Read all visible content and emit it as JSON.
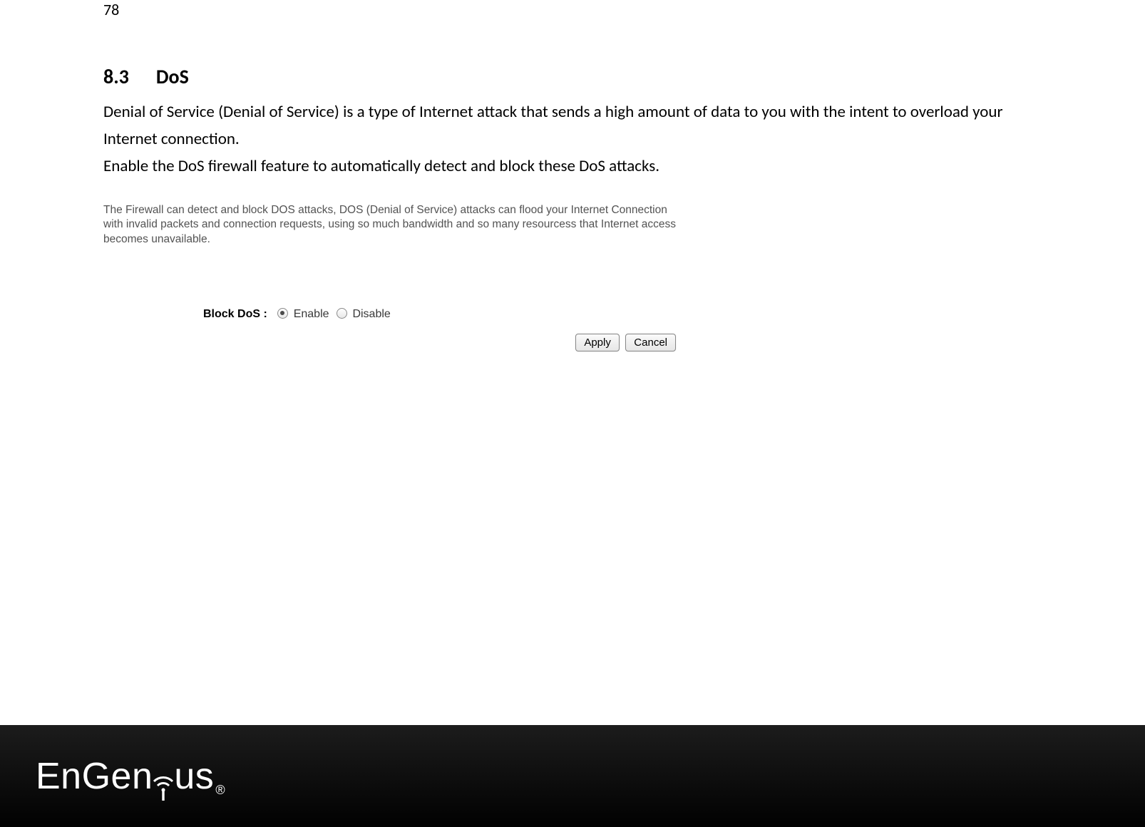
{
  "page_number": "78",
  "section": {
    "number": "8.3",
    "title": "DoS"
  },
  "body": {
    "p1": "Denial of Service (Denial of Service) is a type of Internet attack that sends a high amount of data to you with the intent to overload your Internet connection.",
    "p2": "Enable the DoS firewall feature to automatically detect and block these DoS attacks."
  },
  "screenshot": {
    "description": "The Firewall can detect and block DOS attacks, DOS (Denial of Service) attacks can flood your Internet Connection with invalid packets and connection requests, using so much bandwidth and so many resourcess that Internet access becomes unavailable.",
    "setting_label": "Block DoS :",
    "options": {
      "enable": "Enable",
      "disable": "Disable"
    },
    "selected": "enable",
    "buttons": {
      "apply": "Apply",
      "cancel": "Cancel"
    }
  },
  "footer": {
    "brand_left": "EnGen",
    "brand_right": "us",
    "reg_mark": "®"
  }
}
